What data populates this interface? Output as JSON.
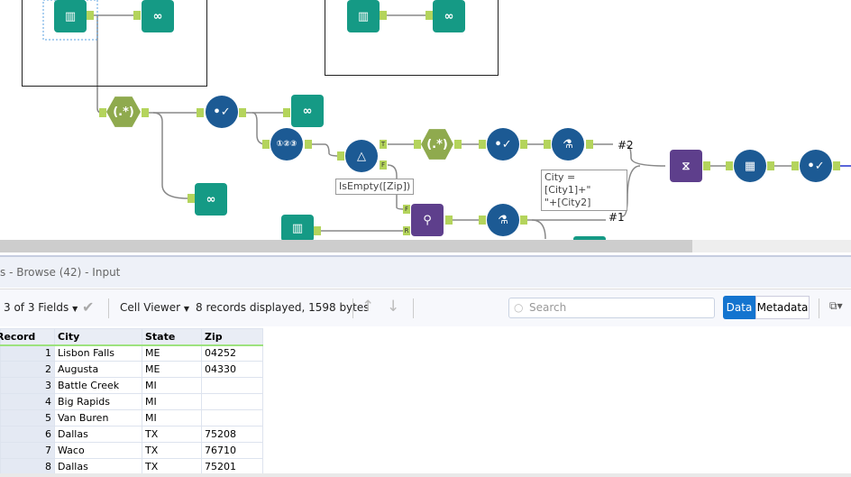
{
  "canvas": {
    "annotations": {
      "filter_expr": "IsEmpty([Zip])",
      "formula_expr_line1": "City = [City1]+\"",
      "formula_expr_line2": "\"+[City2]",
      "label_2": "#2",
      "label_1": "#1"
    },
    "anchors": {
      "true": "T",
      "false": "F",
      "left": "L",
      "right": "R"
    },
    "colors": {
      "tool_blue": "#1c5a94",
      "tool_teal": "#159a85",
      "tool_purple": "#5e3f8c",
      "tool_olive": "#8faa4e",
      "anchor": "#b4d45c"
    }
  },
  "panel": {
    "title": "s - Browse (42) - Input"
  },
  "toolbar": {
    "fields": "3 of 3 Fields",
    "viewer": "Cell Viewer",
    "status": "8 records displayed, 1598 bytes",
    "search_placeholder": "Search",
    "data_tab": "Data",
    "metadata_tab": "Metadata"
  },
  "table": {
    "headers": [
      "Record",
      "City",
      "State",
      "Zip"
    ],
    "rows": [
      [
        "1",
        "Lisbon Falls",
        "ME",
        "04252"
      ],
      [
        "2",
        "Augusta",
        "ME",
        "04330"
      ],
      [
        "3",
        "Battle Creek",
        "MI",
        ""
      ],
      [
        "4",
        "Big Rapids",
        "MI",
        ""
      ],
      [
        "5",
        "Van Buren",
        "MI",
        ""
      ],
      [
        "6",
        "Dallas",
        "TX",
        "75208"
      ],
      [
        "7",
        "Waco",
        "TX",
        "76710"
      ],
      [
        "8",
        "Dallas",
        "TX",
        "75201"
      ]
    ]
  }
}
